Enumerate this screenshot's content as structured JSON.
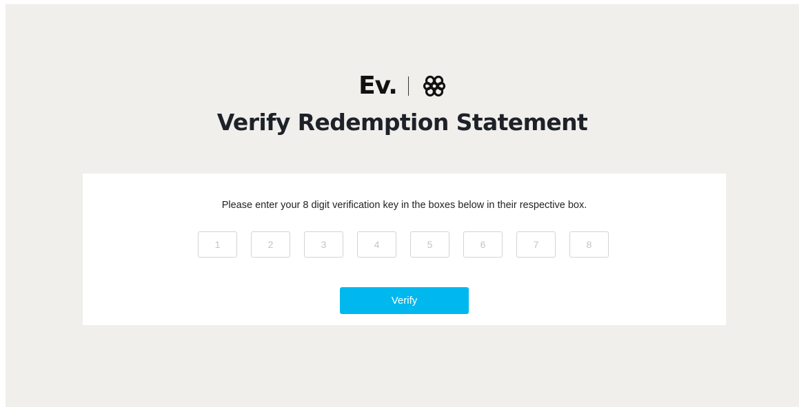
{
  "brand": {
    "name": "Ev.",
    "logo_icon": "knot-logo-icon"
  },
  "title": "Verify Redemption Statement",
  "form": {
    "instructions": "Please enter your 8 digit verification key in the boxes below in their respective box.",
    "digits": [
      {
        "placeholder": "1",
        "value": ""
      },
      {
        "placeholder": "2",
        "value": ""
      },
      {
        "placeholder": "3",
        "value": ""
      },
      {
        "placeholder": "4",
        "value": ""
      },
      {
        "placeholder": "5",
        "value": ""
      },
      {
        "placeholder": "6",
        "value": ""
      },
      {
        "placeholder": "7",
        "value": ""
      },
      {
        "placeholder": "8",
        "value": ""
      }
    ],
    "verify_label": "Verify"
  },
  "colors": {
    "background": "#f0efec",
    "card": "#ffffff",
    "accent": "#00b8ee",
    "title": "#1e2228"
  }
}
